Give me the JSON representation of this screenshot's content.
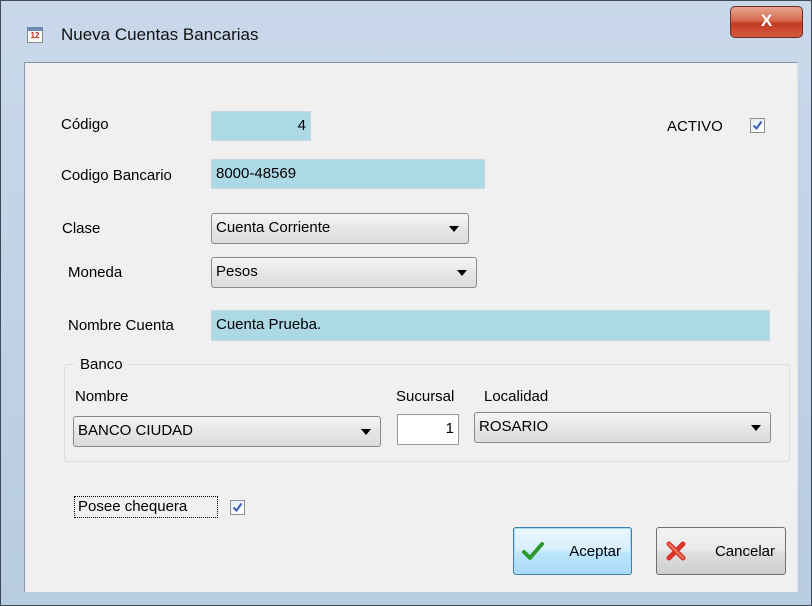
{
  "window": {
    "title": "Nueva Cuentas Bancarias",
    "close_label": "X",
    "title_icon_text": "12"
  },
  "form": {
    "codigo_label": "Código",
    "codigo_value": "4",
    "activo_label": "ACTIVO",
    "activo_checked": true,
    "codigo_bancario_label": "Codigo Bancario",
    "codigo_bancario_value": "8000-48569",
    "clase_label": "Clase",
    "clase_value": "Cuenta Corriente",
    "moneda_label": "Moneda",
    "moneda_value": "Pesos",
    "nombre_cuenta_label": "Nombre Cuenta",
    "nombre_cuenta_value": "Cuenta Prueba."
  },
  "banco": {
    "group_title": "Banco",
    "nombre_label": "Nombre",
    "nombre_value": "BANCO CIUDAD",
    "sucursal_label": "Sucursal",
    "sucursal_value": "1",
    "localidad_label": "Localidad",
    "localidad_value": "ROSARIO"
  },
  "chequera": {
    "label": "Posee chequera",
    "checked": true
  },
  "buttons": {
    "aceptar": "Aceptar",
    "cancelar": "Cancelar"
  },
  "colors": {
    "textbox_bg": "#add8e6",
    "client_bg": "#f0f0f0",
    "close_red": "#c23a22"
  },
  "icons": {
    "title": "calendar-icon",
    "aceptar": "checkmark-icon",
    "cancelar": "red-x-icon"
  }
}
